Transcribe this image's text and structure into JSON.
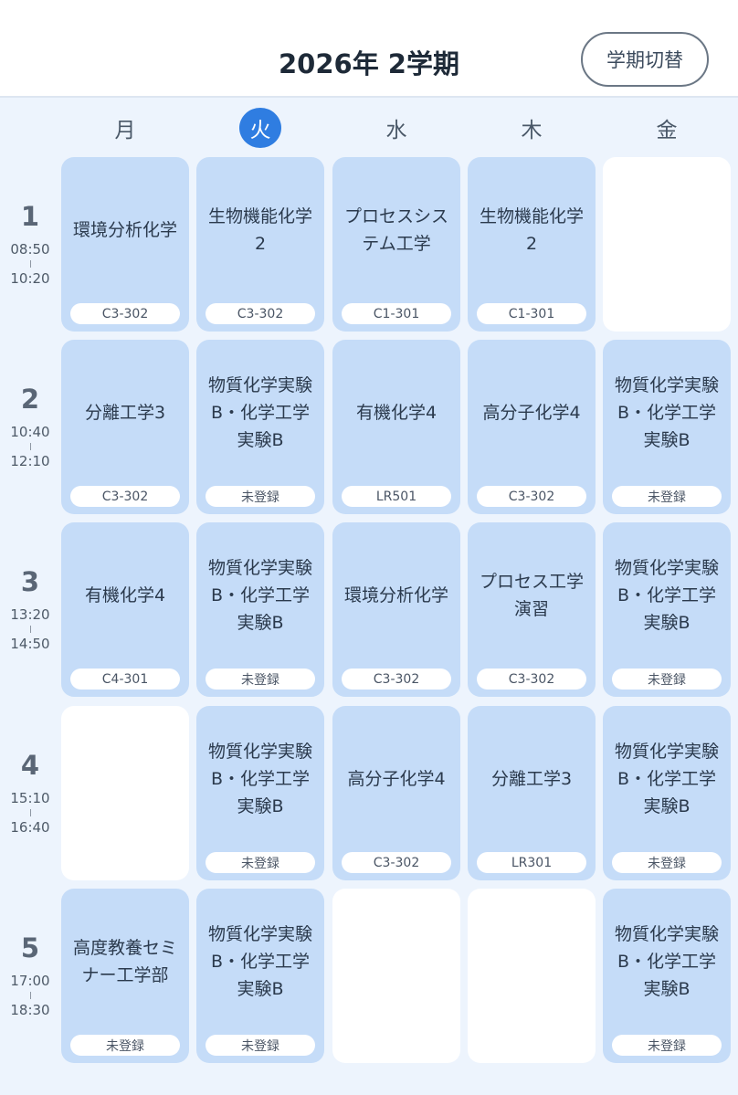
{
  "header": {
    "title": "2026年 2学期",
    "switch_label": "学期切替"
  },
  "days": [
    "月",
    "火",
    "水",
    "木",
    "金"
  ],
  "periods": [
    {
      "num": "1",
      "start": "08:50",
      "end": "10:20"
    },
    {
      "num": "2",
      "start": "10:40",
      "end": "12:10"
    },
    {
      "num": "3",
      "start": "13:20",
      "end": "14:50"
    },
    {
      "num": "4",
      "start": "15:10",
      "end": "16:40"
    },
    {
      "num": "5",
      "start": "17:00",
      "end": "18:30"
    }
  ],
  "grid": [
    [
      {
        "subject": "環境分析化学",
        "room": "C3-302"
      },
      {
        "subject": "生物機能化学\n2",
        "room": "C3-302"
      },
      {
        "subject": "プロセスシス\nテム工学",
        "room": "C1-301"
      },
      {
        "subject": "生物機能化学\n2",
        "room": "C1-301"
      },
      null
    ],
    [
      {
        "subject": "分離工学3",
        "room": "C3-302"
      },
      {
        "subject": "物質化学実験\nB・化学工学\n実験B",
        "room": "未登録"
      },
      {
        "subject": "有機化学4",
        "room": "LR501"
      },
      {
        "subject": "高分子化学4",
        "room": "C3-302"
      },
      {
        "subject": "物質化学実験\nB・化学工学\n実験B",
        "room": "未登録"
      }
    ],
    [
      {
        "subject": "有機化学4",
        "room": "C4-301"
      },
      {
        "subject": "物質化学実験\nB・化学工学\n実験B",
        "room": "未登録"
      },
      {
        "subject": "環境分析化学",
        "room": "C3-302"
      },
      {
        "subject": "プロセス工学\n演習",
        "room": "C3-302"
      },
      {
        "subject": "物質化学実験\nB・化学工学\n実験B",
        "room": "未登録"
      }
    ],
    [
      null,
      {
        "subject": "物質化学実験\nB・化学工学\n実験B",
        "room": "未登録"
      },
      {
        "subject": "高分子化学4",
        "room": "C3-302"
      },
      {
        "subject": "分離工学3",
        "room": "LR301"
      },
      {
        "subject": "物質化学実験\nB・化学工学\n実験B",
        "room": "未登録"
      }
    ],
    [
      {
        "subject": "高度教養セミ\nナー工学部",
        "room": "未登録"
      },
      {
        "subject": "物質化学実験\nB・化学工学\n実験B",
        "room": "未登録"
      },
      null,
      null,
      {
        "subject": "物質化学実験\nB・化学工学\n実験B",
        "room": "未登録"
      }
    ]
  ],
  "today_index": 1,
  "colors": {
    "accent": "#2f7de1",
    "cell": "#c5dcf8",
    "background": "#edf4fd"
  }
}
